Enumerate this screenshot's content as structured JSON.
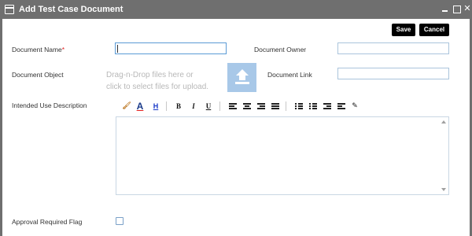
{
  "window": {
    "title": "Add Test Case Document",
    "icon": "document-window-icon",
    "controls": [
      "minimize-icon",
      "maximize-icon",
      "close-icon"
    ]
  },
  "actions": {
    "save_label": "Save",
    "cancel_label": "Cancel"
  },
  "form": {
    "document_name_label": "Document Name",
    "required_marker": "*",
    "document_name_value": "",
    "document_owner_label": "Document Owner",
    "document_owner_value": "",
    "document_object_label": "Document Object",
    "drop_hint_line1": "Drag-n-Drop files here or",
    "drop_hint_line2": "click to select files for upload.",
    "document_link_label": "Document Link",
    "document_link_value": "",
    "intended_use_label": "Intended Use Description",
    "intended_use_value": "",
    "approval_label": "Approval Required Flag",
    "approval_checked": false
  },
  "toolbar": {
    "bold": "B",
    "italic": "I",
    "underline": "U",
    "font_color": "A",
    "highlight": "H"
  },
  "colors": {
    "titlebar": "#6f6f6f",
    "button": "#000000",
    "upload_box": "#a8c8e8",
    "required": "#e02020"
  }
}
